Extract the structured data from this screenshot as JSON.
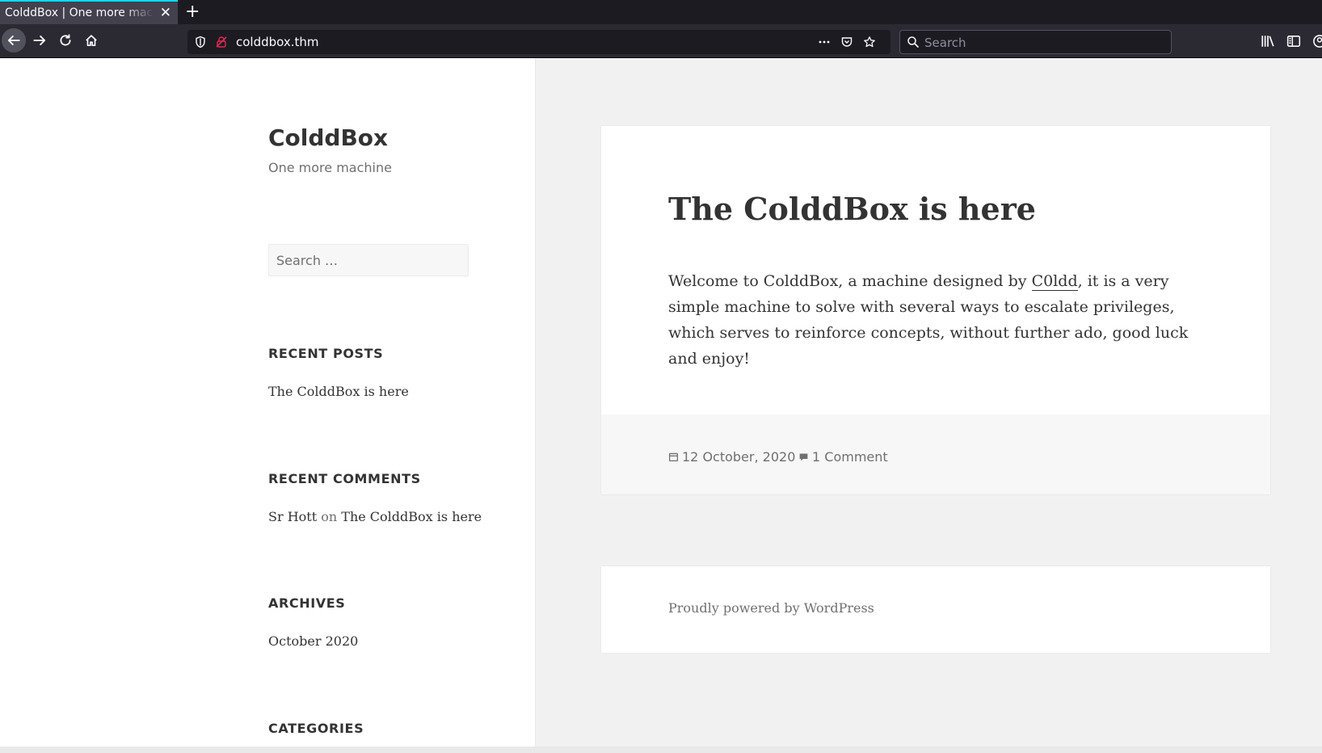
{
  "browser": {
    "tab_title": "ColddBox | One more machine",
    "tab_close": "✕",
    "new_tab": "+",
    "url": "colddbox.thm",
    "search_placeholder": "Search",
    "accent_color": "#00ddff"
  },
  "sidebar": {
    "site_title": "ColddBox",
    "site_description": "One more machine",
    "search_placeholder": "Search …",
    "recent_posts": {
      "title": "RECENT POSTS",
      "items": [
        "The ColddBox is here"
      ]
    },
    "recent_comments": {
      "title": "RECENT COMMENTS",
      "author": "Sr Hott",
      "on": "on",
      "post": "The ColddBox is here"
    },
    "archives": {
      "title": "ARCHIVES",
      "items": [
        "October 2020"
      ]
    },
    "categories": {
      "title": "CATEGORIES"
    }
  },
  "post": {
    "title": "The ColddBox is here",
    "content_before": "Welcome to ColddBox, a machine designed by ",
    "author_link": "C0ldd",
    "content_after": ", it is a very simple machine to solve with several ways to escalate privileges, which serves to reinforce concepts, without further ado, good luck and enjoy!",
    "date": "12 October, 2020",
    "comments": "1 Comment"
  },
  "footer": {
    "powered_by": "Proudly powered by WordPress"
  }
}
